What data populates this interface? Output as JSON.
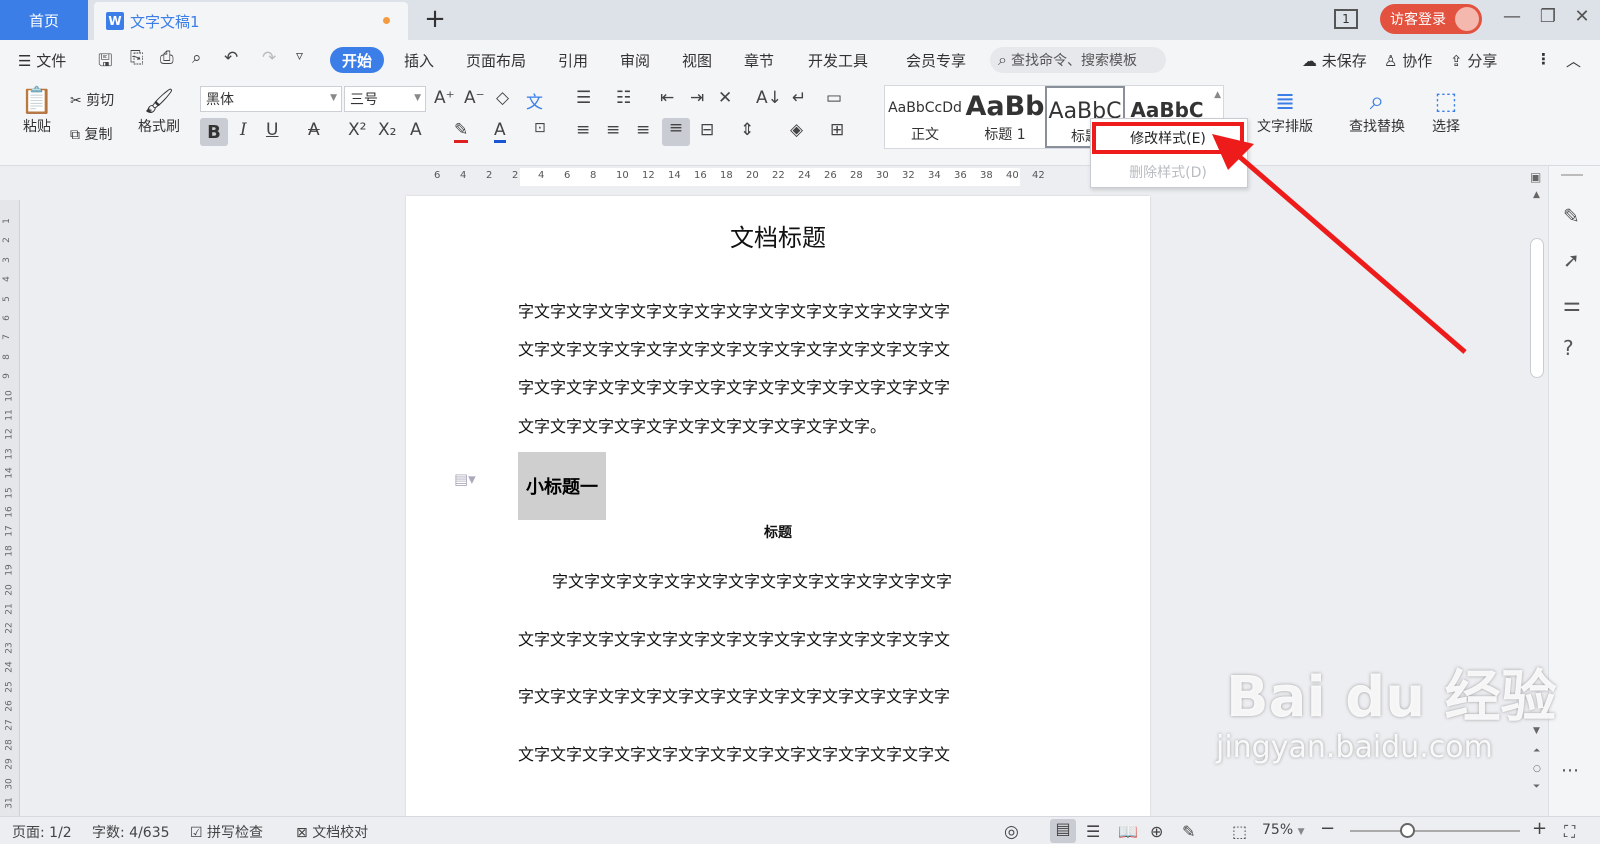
{
  "tabs": {
    "home": "首页",
    "doc_icon": "W",
    "doc_title": "文字文稿1",
    "new_tab": "+"
  },
  "header": {
    "page_indicator": "1",
    "login": "访客登录"
  },
  "menu": {
    "file": "文件",
    "items": [
      "开始",
      "插入",
      "页面布局",
      "引用",
      "审阅",
      "视图",
      "章节",
      "开发工具",
      "会员专享"
    ],
    "search_placeholder": "查找命令、搜索模板",
    "unsaved": "未保存",
    "collab": "协作",
    "share": "分享"
  },
  "ribbon": {
    "paste": "粘贴",
    "cut": "剪切",
    "copy": "复制",
    "format_painter": "格式刷",
    "font_name": "黑体",
    "font_size": "三号",
    "bold": "B",
    "italic": "I",
    "underline": "U",
    "text_layout": "文字排版",
    "find_replace": "查找替换",
    "select": "选择"
  },
  "styles": [
    {
      "preview": "AaBbCcDd",
      "name": "正文"
    },
    {
      "preview": "AaBb",
      "name": "标题 1"
    },
    {
      "preview": "AaBbC",
      "name": "标题"
    },
    {
      "preview": "AaBbC",
      "name": ""
    }
  ],
  "context_menu": {
    "modify": "修改样式(E)",
    "delete": "删除样式(D)"
  },
  "ruler_labels": [
    "6",
    "4",
    "2",
    "2",
    "4",
    "6",
    "8",
    "10",
    "12",
    "14",
    "16",
    "18",
    "20",
    "22",
    "24",
    "26",
    "28",
    "30",
    "32",
    "34",
    "36",
    "38",
    "40",
    "42"
  ],
  "vruler_labels": [
    "1",
    "2",
    "3",
    "4",
    "5",
    "6",
    "7",
    "8",
    "9",
    "10",
    "11",
    "12",
    "13",
    "14",
    "15",
    "16",
    "17",
    "18",
    "19",
    "20",
    "21",
    "22",
    "23",
    "24",
    "25",
    "26",
    "27",
    "28",
    "29",
    "30",
    "31"
  ],
  "document": {
    "title": "文档标题",
    "para1": [
      "字文字文字文字文字文字文字文字文字文字文字文字文字文字",
      "文字文字文字文字文字文字文字文字文字文字文字文字文字文",
      "字文字文字文字文字文字文字文字文字文字文字文字文字文字",
      "文字文字文字文字文字文字文字文字文字文字文字。"
    ],
    "subheading": "小标题一",
    "centered_title": "标题",
    "para2": [
      "字文字文字文字文字文字文字文字文字文字文字文字文字",
      "文字文字文字文字文字文字文字文字文字文字文字文字文字文",
      "字文字文字文字文字文字文字文字文字文字文字文字文字文字",
      "文字文字文字文字文字文字文字文字文字文字文字文字文字文"
    ]
  },
  "statusbar": {
    "page": "页面: 1/2",
    "words": "字数: 4/635",
    "spell": "拼写检查",
    "proof": "文档校对",
    "zoom": "75%"
  },
  "watermark": {
    "logo": "Bai du 经验",
    "url": "jingyan.baidu.com"
  },
  "colors": {
    "accent": "#3b7ee8",
    "highlight_red": "#ee1b1b",
    "login_bg": "#e2523f"
  }
}
